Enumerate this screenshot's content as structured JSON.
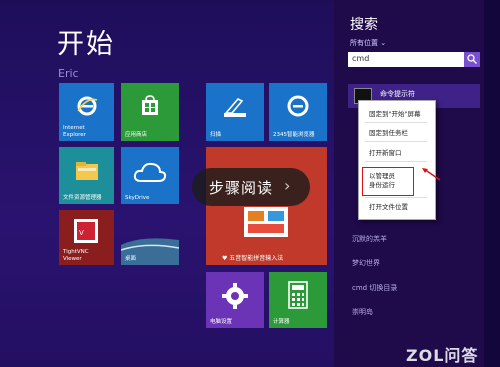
{
  "start": {
    "title": "开始",
    "user": "Eric"
  },
  "tiles": {
    "ie": "Internet Explorer",
    "store": "应用商店",
    "scan": "扫描",
    "game2345": "2345智能浏览器",
    "explorer": "文件资源管理器",
    "skydrive": "SkyDrive",
    "tightvnc": "TightVNC Viewer",
    "desktop": "桌面",
    "five": "五音智能拼音输入法",
    "pcsettings": "电脑设置",
    "calculator": "计算器"
  },
  "overlay": {
    "label": "步骤阅读",
    "chevron": "›"
  },
  "search": {
    "title": "搜索",
    "scope": "所有位置",
    "query": "cmd",
    "top_result": "命令提示符",
    "results": [
      "沉默的羔羊",
      "梦幻世界",
      "cmd 切换目录",
      "崇明岛"
    ]
  },
  "context_menu": {
    "items": [
      "固定到\"开始\"屏幕",
      "固定到任务栏",
      "打开新窗口",
      "以管理员",
      "身份运行",
      "打开文件位置"
    ]
  },
  "watermark": "ZOL问答",
  "colors": {
    "background": "#241065",
    "tile_blue": "#1a73c8",
    "tile_green": "#2d9a3a",
    "tile_teal": "#1d8f9a",
    "tile_red": "#c0392b",
    "tile_purple": "#6b33b5",
    "highlight": "#d11111"
  }
}
